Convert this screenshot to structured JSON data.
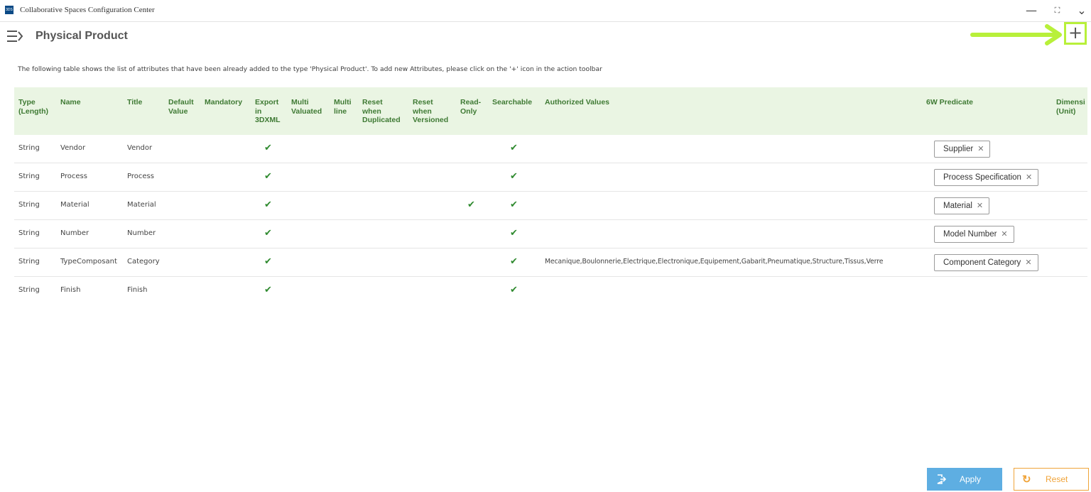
{
  "window": {
    "title": "Collaborative Spaces Configuration Center",
    "logo_text": "3DS",
    "minimize_glyph": "—",
    "maximize_glyph": "⛶",
    "dropdown_glyph": "⌄"
  },
  "header": {
    "page_title": "Physical Product",
    "add_glyph": "+",
    "highlight_color": "#b8f03a"
  },
  "description": "The following table shows the list of attributes that have been already added to the type 'Physical Product'. To add new Attributes, please click on the '+' icon in the action toolbar",
  "table": {
    "columns": [
      "Type\n(Length)",
      "Name",
      "Title",
      "Default\nValue",
      "Mandatory",
      "Export\nin\n3DXML",
      "Multi\nValuated",
      "Multi\nline",
      "Reset\nwhen\nDuplicated",
      "Reset\nwhen\nVersioned",
      "Read-\nOnly",
      "Searchable",
      "Authorized Values",
      "6W Predicate",
      "Dimensi\n(Unit)"
    ],
    "rows": [
      {
        "type": "String",
        "name": "Vendor",
        "title": "Vendor",
        "export": "✔",
        "readonly": "",
        "searchable": "✔",
        "authorized": "",
        "predicate": "Supplier"
      },
      {
        "type": "String",
        "name": "Process",
        "title": "Process",
        "export": "✔",
        "readonly": "",
        "searchable": "✔",
        "authorized": "",
        "predicate": "Process Specification"
      },
      {
        "type": "String",
        "name": "Material",
        "title": "Material",
        "export": "✔",
        "readonly": "✔",
        "searchable": "✔",
        "authorized": "",
        "predicate": "Material"
      },
      {
        "type": "String",
        "name": "Number",
        "title": "Number",
        "export": "✔",
        "readonly": "",
        "searchable": "✔",
        "authorized": "",
        "predicate": "Model Number"
      },
      {
        "type": "String",
        "name": "TypeComposant",
        "title": "Category",
        "export": "✔",
        "readonly": "",
        "searchable": "✔",
        "authorized": "Mecanique,Boulonnerie,Electrique,Electronique,Equipement,Gabarit,Pneumatique,Structure,Tissus,Verre",
        "predicate": "Component Category"
      },
      {
        "type": "String",
        "name": "Finish",
        "title": "Finish",
        "export": "✔",
        "readonly": "",
        "searchable": "✔",
        "authorized": "",
        "predicate": ""
      }
    ],
    "chip_remove_glyph": "✕"
  },
  "footer": {
    "apply_label": "Apply",
    "reset_label": "Reset",
    "reset_glyph": "↻",
    "apply_color": "#5eaee2",
    "reset_color": "#f0a43a"
  }
}
